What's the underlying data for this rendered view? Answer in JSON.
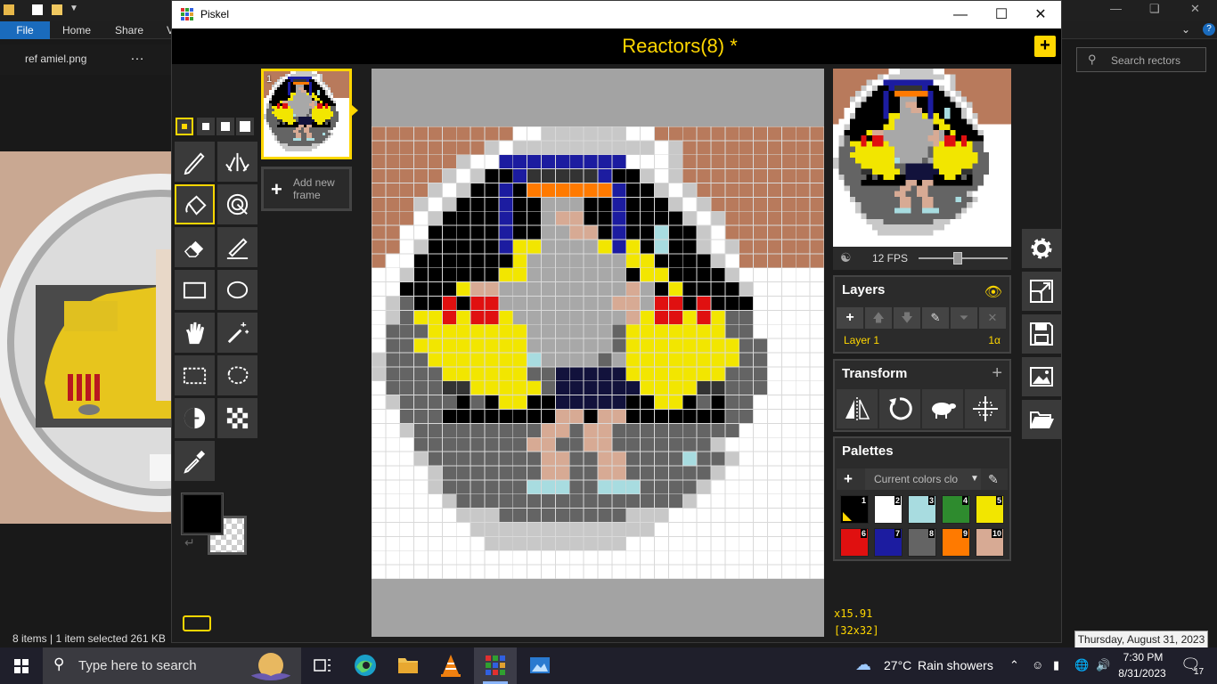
{
  "explorer": {
    "ribbon_tabs": [
      "File",
      "Home",
      "Share",
      "V"
    ],
    "tab_name": "ref amiel.png",
    "tab_more": "…",
    "search_placeholder": "Search rectors",
    "status": "8 items  |  1 item selected  261 KB"
  },
  "piskel": {
    "window_title": "Piskel",
    "document_title": "Reactors(8) *",
    "add_frame_label": "Add new frame",
    "frame_number": "1",
    "zoom": "x15.91",
    "size": "[32x32]",
    "fps_label": "12 FPS",
    "fps_value": 12,
    "fps_slider_fraction": 0.44,
    "layers": {
      "title": "Layers",
      "items": [
        {
          "name": "Layer 1",
          "alpha": "1α"
        }
      ]
    },
    "transform": {
      "title": "Transform"
    },
    "palettes": {
      "title": "Palettes",
      "selected_palette": "Current colors clo",
      "swatches": [
        {
          "num": "1",
          "color": "#000000"
        },
        {
          "num": "2",
          "color": "#ffffff"
        },
        {
          "num": "3",
          "color": "#a8dce0"
        },
        {
          "num": "4",
          "color": "#2e8b2e"
        },
        {
          "num": "5",
          "color": "#f2e600"
        },
        {
          "num": "6",
          "color": "#e01010"
        },
        {
          "num": "7",
          "color": "#1c1ca0"
        },
        {
          "num": "8",
          "color": "#646464"
        },
        {
          "num": "9",
          "color": "#ff7a00"
        },
        {
          "num": "10",
          "color": "#d7aa94"
        }
      ]
    },
    "primary_color": "#000000",
    "secondary_color": "transparent",
    "accent_color": "#ffd700",
    "sprite_palette": {
      ".": "#ffffff",
      "b": "#b87a5c",
      "l": "#c8c8c8",
      "K": "#000000",
      "N": "#1c1ca0",
      "O": "#ff7a00",
      "s": "#d7aa94",
      "g": "#a8a8a8",
      "Y": "#f2e600",
      "d": "#646464",
      "R": "#e01010",
      "t": "#a8dce0",
      "n": "#12123c",
      "e": "#333333"
    },
    "sprite_rows": [
      "bbbbbbbbbb..llllll..bbbbbbbbbbbb",
      "bbbbbbbbl.llllllllll.lbbbbbbbbbb",
      "bbbbbbl..NNNNNNNNN...lbbbbbbbbbb",
      "bbbbbl.lKKNeeeeeNKKl.lbbbbbbbbbb",
      "bbbbl.lKKNKOOOOOONKKl.lbbbbbbbbb",
      "bbbl.lKKKNKKgggKKNKKKl.lbbbbbbbb",
      "bbb.lKKKKNKKgssKKNKKKKl.lbbbbbbb",
      "bb..KKKKKNKKggssKNKKtKKl.bbbbbbb",
      "bb.lKKKKKNYYggggYNYKtKKl.lbbbbbb",
      "b..KKKKKKKYgggggggYYKKKKl.bbbbbb",
      "..lKKKKKKYYgggggggKYYKKKKl.....",
      "..KKKKYssgggggggggsgKYKKKKl.....",
      ".ldKKRKRRggggggggssgRRKRKKK.....",
      ".ldYYRYRRYggggggggsYRRYRYdd.....",
      ".dddYYYYYYYggggggdYYYYYYYdd.....",
      ".ddYYYYYYYYggggggdYYYYYYYYdd....",
      "ldddYYYYYYYtggggdgYYYYYYYYdd....",
      "lddddYYYYYYddnnnnnYYYYYYYddd....",
      ".ddddeeYYYYYdnnnnnnYYYYeeddd....",
      ".lddddKdKYYKKnnnnnKKYYKdKdd.....",
      "..dddKKKKKKKKssKssKKKKKKKdd.....",
      "..ldddddddddssdssddddddddd......",
      "...ddddddddssddssdddddddl.......",
      "...lddddddddssddssddddtddl......",
      "....ldddddddssddssddddddl.......",
      "....lddddddtttddtttddddl........",
      ".....lddddddddddddddddl.........",
      "......llldddddddddlll...........",
      ".......lllllllllllll............",
      "........llllllllll..............",
      "................................",
      "................................"
    ]
  },
  "taskbar": {
    "search_placeholder": "Type here to search",
    "weather_temp": "27°C",
    "weather_desc": "Rain showers",
    "time": "7:30 PM",
    "date": "8/31/2023",
    "notif_count": "17",
    "tooltip": "Thursday, August 31, 2023"
  }
}
